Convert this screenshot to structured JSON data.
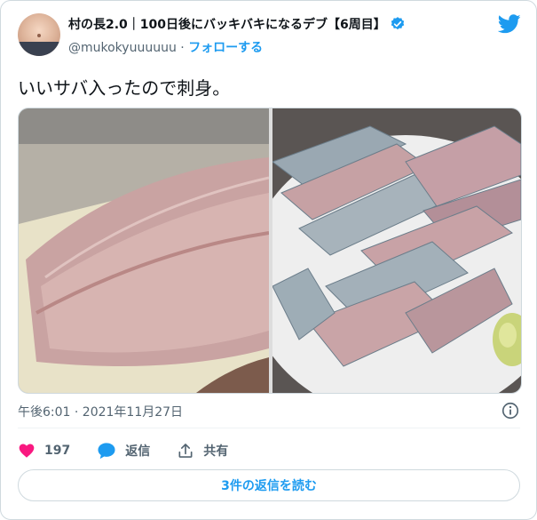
{
  "author": {
    "display_name": "村の長2.0｜100日後にバッキバキになるデブ【6周目】",
    "handle": "@mukokyuuuuuu",
    "separator": "·",
    "follow_label": "フォローする"
  },
  "tweet": {
    "text": "いいサバ入ったので刺身。",
    "timestamp": "午後6:01 · 2021年11月27日"
  },
  "actions": {
    "like_count": "197",
    "reply_label": "返信",
    "share_label": "共有"
  },
  "read_replies_label": "3件の返信を読む",
  "colors": {
    "accent": "#1d9bf0",
    "like": "#f91880",
    "secondary_text": "#536471",
    "border": "#cfd9de"
  },
  "icons": [
    "verified-icon",
    "twitter-logo-icon",
    "info-icon",
    "heart-icon",
    "reply-bubble-icon",
    "share-icon"
  ]
}
